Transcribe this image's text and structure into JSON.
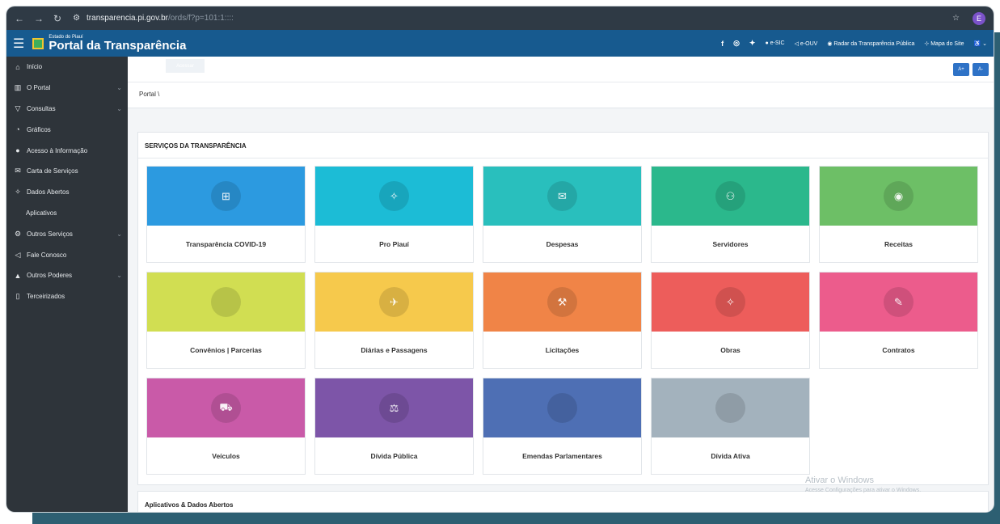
{
  "browser": {
    "nav_icons": [
      "back-arrow-icon",
      "forward-arrow-icon",
      "reload-icon"
    ],
    "url_host": "transparencia.pi.gov.br",
    "url_path": "/ords/f?p=101:1::::",
    "profile_initial": "E"
  },
  "header": {
    "logo_small": "Estado do Piauí",
    "logo_title": "Portal da Transparência",
    "links": {
      "esic": "e-SIC",
      "eouv": "e-OUV",
      "radar": "Radar da Transparência Pública",
      "mapa": "Mapa do Site"
    },
    "social_icons": [
      "facebook-icon",
      "instagram-icon",
      "twitter-icon"
    ]
  },
  "sidebar": {
    "items": [
      {
        "label": "Início",
        "icon": "home-icon"
      },
      {
        "label": "O Portal",
        "icon": "bank-icon"
      },
      {
        "label": "Consultas",
        "icon": "filter-icon"
      },
      {
        "label": "Gráficos",
        "icon": "chart-icon"
      },
      {
        "label": "Acesso à Informação",
        "icon": "info-icon"
      },
      {
        "label": "Carta de Serviços",
        "icon": "envelope-icon"
      },
      {
        "label": "Dados Abertos",
        "icon": "puzzle-icon"
      },
      {
        "label": "Aplicativos",
        "icon": ""
      },
      {
        "label": "Outros Serviços",
        "icon": "gear-icon"
      },
      {
        "label": "Fale Conosco",
        "icon": "megaphone-icon"
      },
      {
        "label": "Outros Poderes",
        "icon": "building-icon"
      },
      {
        "label": "Terceirizados",
        "icon": "file-icon"
      }
    ]
  },
  "main": {
    "acessar_label": "Acessar",
    "font_increase": "A+",
    "font_decrease": "A-",
    "breadcrumb": "Portal",
    "services_title": "SERVIÇOS DA TRANSPARÊNCIA",
    "tiles": [
      {
        "label": "Transparência COVID-19",
        "color": "#2c9ae0",
        "icon": "ambulance-icon"
      },
      {
        "label": "Pro Piauí",
        "color": "#1cbcd6",
        "icon": "puzzle-icon"
      },
      {
        "label": "Despesas",
        "color": "#29bfbd",
        "icon": "envelope-icon"
      },
      {
        "label": "Servidores",
        "color": "#2bb88c",
        "icon": "users-icon"
      },
      {
        "label": "Receitas",
        "color": "#6dbf66",
        "icon": "coin-icon"
      },
      {
        "label": "Convênios | Parcerias",
        "color": "#d1de52",
        "icon": "blank-icon"
      },
      {
        "label": "Diárias e Passagens",
        "color": "#f6c94c",
        "icon": "plane-icon"
      },
      {
        "label": "Licitações",
        "color": "#f08447",
        "icon": "gavel-icon"
      },
      {
        "label": "Obras",
        "color": "#ed5d5b",
        "icon": "puzzle-icon"
      },
      {
        "label": "Contratos",
        "color": "#ec5c8c",
        "icon": "edit-icon"
      },
      {
        "label": "Veículos",
        "color": "#c95aa8",
        "icon": "car-icon"
      },
      {
        "label": "Dívida Pública",
        "color": "#7d55a8",
        "icon": "scale-icon"
      },
      {
        "label": "Emendas Parlamentares",
        "color": "#4e6fb4",
        "icon": "blank-icon"
      },
      {
        "label": "Dívida Ativa",
        "color": "#a3b2bd",
        "icon": "blank-icon"
      }
    ],
    "apps_title": "Aplicativos & Dados Abertos"
  },
  "watermark": {
    "line1": "Ativar o Windows",
    "line2": "Acesse Configurações para ativar o Windows."
  }
}
